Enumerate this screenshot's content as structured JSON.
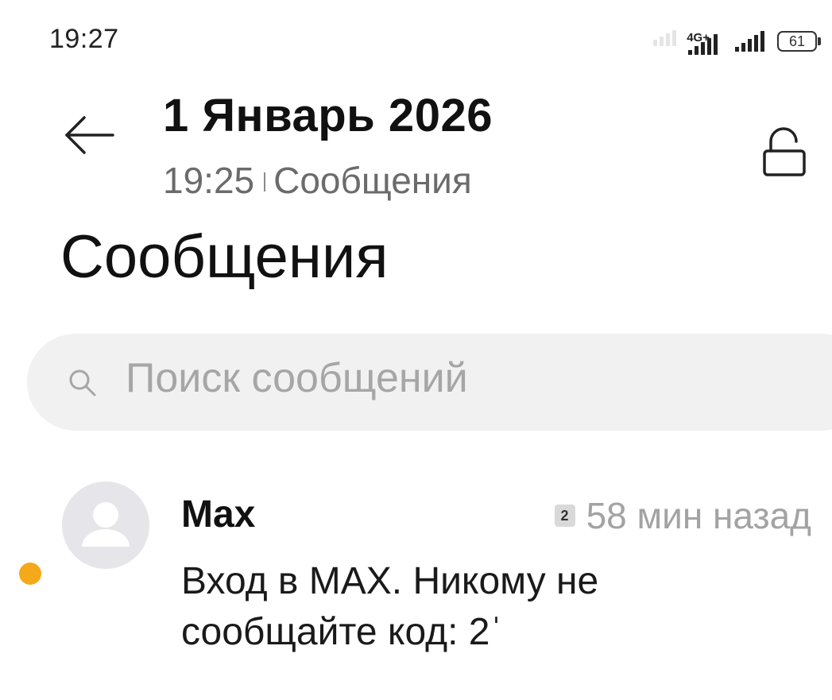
{
  "status_bar": {
    "time": "19:27",
    "network": "4G+",
    "battery": "61"
  },
  "header": {
    "title": "1 Январь 2026",
    "sub_time": "19:25",
    "sub_app": "Сообщения"
  },
  "page": {
    "title": "Сообщения"
  },
  "search": {
    "placeholder": "Поиск сообщений"
  },
  "conversations": [
    {
      "sender": "Max",
      "sim": "2",
      "time_ago": "58 мин назад",
      "preview": "Вход в МАХ. Никому не сообщайте код: 2ˈ",
      "unread": true
    }
  ],
  "colors": {
    "unread_dot": "#f3a91a",
    "search_bg": "#f1f1f1",
    "avatar_bg": "#e6e6ea"
  }
}
